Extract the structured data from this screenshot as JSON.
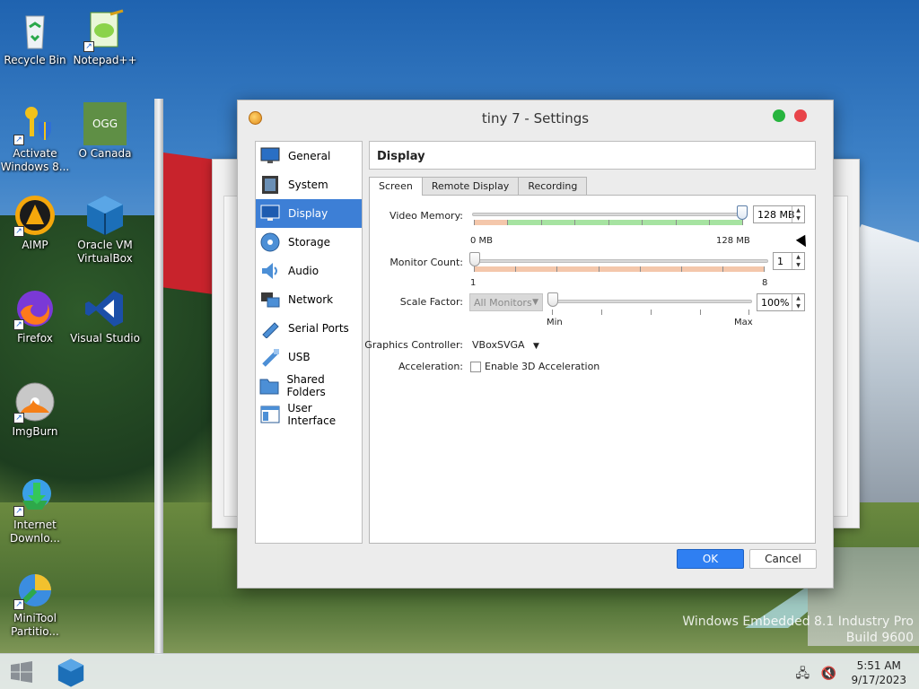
{
  "desktop": {
    "icons": [
      {
        "label": "Recycle Bin"
      },
      {
        "label": "Notepad++"
      },
      {
        "label": "Activate Windows 8..."
      },
      {
        "label": "O Canada"
      },
      {
        "label": "AIMP"
      },
      {
        "label": "Oracle VM VirtualBox"
      },
      {
        "label": "Firefox"
      },
      {
        "label": "Visual Studio"
      },
      {
        "label": "ImgBurn"
      },
      {
        "label": "Internet Downlo..."
      },
      {
        "label": "MiniTool Partitio..."
      }
    ],
    "ogg_badge": "OGG",
    "watermark_line1": "Windows Embedded 8.1 Industry Pro",
    "watermark_line2": "Build 9600"
  },
  "dialog": {
    "title": "tiny 7 - Settings",
    "sidebar": {
      "items": [
        {
          "label": "General",
          "icon": "general-icon"
        },
        {
          "label": "System",
          "icon": "system-icon"
        },
        {
          "label": "Display",
          "icon": "display-icon",
          "active": true
        },
        {
          "label": "Storage",
          "icon": "storage-icon"
        },
        {
          "label": "Audio",
          "icon": "audio-icon"
        },
        {
          "label": "Network",
          "icon": "network-icon"
        },
        {
          "label": "Serial Ports",
          "icon": "serial-ports-icon"
        },
        {
          "label": "USB",
          "icon": "usb-icon"
        },
        {
          "label": "Shared Folders",
          "icon": "shared-folders-icon"
        },
        {
          "label": "User Interface",
          "icon": "user-interface-icon"
        }
      ]
    },
    "panel_title": "Display",
    "tabs": [
      {
        "label": "Screen",
        "active": true
      },
      {
        "label": "Remote Display"
      },
      {
        "label": "Recording"
      }
    ],
    "screen": {
      "video_memory": {
        "label": "Video Memory:",
        "value": "128 MB",
        "min_label": "0 MB",
        "max_label": "128 MB"
      },
      "monitor_count": {
        "label": "Monitor Count:",
        "value": "1",
        "min_label": "1",
        "max_label": "8"
      },
      "scale_factor": {
        "label": "Scale Factor:",
        "target": "All Monitors",
        "value": "100%",
        "min_label": "Min",
        "max_label": "Max"
      },
      "graphics_controller": {
        "label": "Graphics Controller:",
        "value": "VBoxSVGA"
      },
      "acceleration": {
        "label": "Acceleration:",
        "checkbox_label": "Enable 3D Acceleration",
        "checked": false
      }
    },
    "buttons": {
      "ok": "OK",
      "cancel": "Cancel"
    }
  },
  "taskbar": {
    "time": "5:51 AM",
    "date": "9/17/2023"
  },
  "colors": {
    "accent": "#3d7fd6",
    "ok_button": "#2f7ff2",
    "close_button": "#e8444a",
    "min_button": "#27b43e",
    "recommended_range": "#a6e3a1",
    "warning_range": "#f4c7ab"
  }
}
